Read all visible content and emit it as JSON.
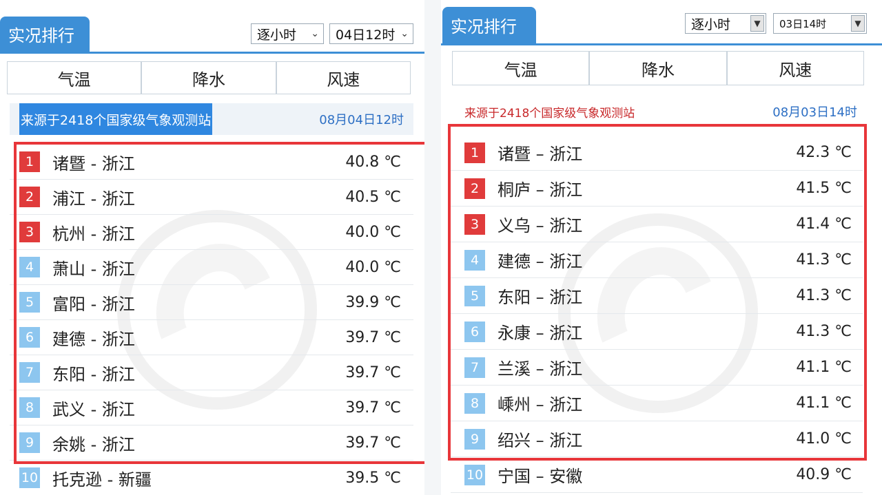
{
  "left": {
    "header_title": "实况排行",
    "period_select": "逐小时",
    "time_select": "04日12时",
    "tabs": [
      {
        "label": "气温",
        "active": true
      },
      {
        "label": "降水",
        "active": false
      },
      {
        "label": "风速",
        "active": false
      }
    ],
    "source_text": "来源于2418个国家级气象观测站",
    "source_time": "08月04日12时",
    "rows": [
      {
        "rank": "1",
        "station": "诸暨 - 浙江",
        "temp": "40.8 ℃"
      },
      {
        "rank": "2",
        "station": "浦江 - 浙江",
        "temp": "40.5 ℃"
      },
      {
        "rank": "3",
        "station": "杭州 - 浙江",
        "temp": "40.0 ℃"
      },
      {
        "rank": "4",
        "station": "萧山 - 浙江",
        "temp": "40.0 ℃"
      },
      {
        "rank": "5",
        "station": "富阳 - 浙江",
        "temp": "39.9 ℃"
      },
      {
        "rank": "6",
        "station": "建德 - 浙江",
        "temp": "39.7 ℃"
      },
      {
        "rank": "7",
        "station": "东阳 - 浙江",
        "temp": "39.7 ℃"
      },
      {
        "rank": "8",
        "station": "武义 - 浙江",
        "temp": "39.7 ℃"
      },
      {
        "rank": "9",
        "station": "余姚 - 浙江",
        "temp": "39.7 ℃"
      },
      {
        "rank": "10",
        "station": "托克逊 - 新疆",
        "temp": "39.5 ℃"
      }
    ]
  },
  "right": {
    "header_title": "实况排行",
    "period_select": "逐小时",
    "time_select": "03日14时",
    "tabs": [
      {
        "label": "气温",
        "active": true
      },
      {
        "label": "降水",
        "active": false
      },
      {
        "label": "风速",
        "active": false
      }
    ],
    "source_text": "来源于2418个国家级气象观测站",
    "source_time": "08月03日14时",
    "rows": [
      {
        "rank": "1",
        "station": "诸暨 – 浙江",
        "temp": "42.3 ℃"
      },
      {
        "rank": "2",
        "station": "桐庐 – 浙江",
        "temp": "41.5 ℃"
      },
      {
        "rank": "3",
        "station": "义乌 – 浙江",
        "temp": "41.4 ℃"
      },
      {
        "rank": "4",
        "station": "建德 – 浙江",
        "temp": "41.3 ℃"
      },
      {
        "rank": "5",
        "station": "东阳 – 浙江",
        "temp": "41.3 ℃"
      },
      {
        "rank": "6",
        "station": "永康 – 浙江",
        "temp": "41.3 ℃"
      },
      {
        "rank": "7",
        "station": "兰溪 – 浙江",
        "temp": "41.1 ℃"
      },
      {
        "rank": "8",
        "station": "嵊州 – 浙江",
        "temp": "41.1 ℃"
      },
      {
        "rank": "9",
        "station": "绍兴 – 浙江",
        "temp": "41.0 ℃"
      },
      {
        "rank": "10",
        "station": "宁国 – 安徽",
        "temp": "40.9 ℃"
      }
    ]
  },
  "colors": {
    "accent": "#3d8fd6",
    "top_rank": "#e03b3b",
    "rest_rank": "#8dc6ef",
    "highlight": "#e8363a"
  }
}
